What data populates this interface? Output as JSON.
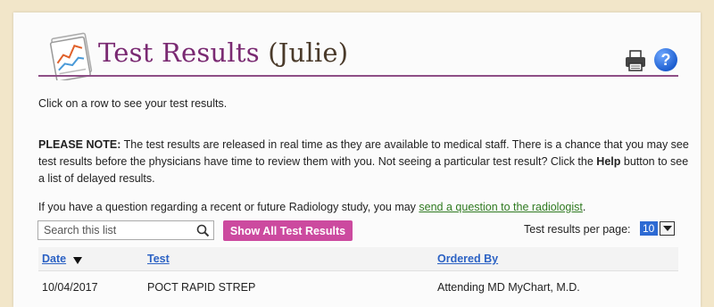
{
  "header": {
    "title": "Test Results",
    "patient": "(Julie)",
    "icons": [
      "document-chart-icon",
      "printer-icon",
      "help-icon"
    ],
    "help_glyph": "?"
  },
  "instructions": {
    "click_row": "Click on a row to see your test results.",
    "note_label": "PLEASE NOTE:",
    "note_body_1": " The test results are released in real time as they are available to medical staff. There is a chance that you may see test results before the physicians have time to review them with you. Not seeing a particular test result? Click the ",
    "note_help_word": "Help",
    "note_body_2": " button to see a list of delayed results.",
    "radiology_prefix": "If you have a question regarding a recent or future Radiology study, you may ",
    "radiology_link": "send a question to the radiologist",
    "radiology_suffix": "."
  },
  "controls": {
    "search_placeholder": "Search this list",
    "show_all_label": "Show All Test Results",
    "per_page_label": "Test results per page:",
    "per_page_value": "10"
  },
  "table": {
    "columns": {
      "date": "Date",
      "test": "Test",
      "ordered_by": "Ordered By"
    },
    "rows": [
      {
        "date": "10/04/2017",
        "test": "POCT RAPID STREP",
        "ordered_by": "Attending MD MyChart, M.D."
      }
    ]
  },
  "colors": {
    "title": "#7a2a72",
    "accent_button": "#cc4a9f",
    "link_green": "#2f7a20",
    "header_link_blue": "#2c62c4",
    "background": "#f2e6c9"
  }
}
